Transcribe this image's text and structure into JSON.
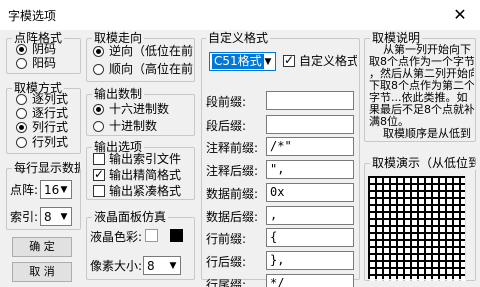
{
  "window": {
    "title": "字模选项",
    "close_glyph": "✕"
  },
  "dot_format": {
    "label": "点阵格式",
    "options": [
      {
        "label": "阴码",
        "selected": true
      },
      {
        "label": "阳码",
        "selected": false
      }
    ]
  },
  "scan_mode": {
    "label": "取模方式",
    "options": [
      {
        "label": "逐列式",
        "selected": false
      },
      {
        "label": "逐行式",
        "selected": false
      },
      {
        "label": "列行式",
        "selected": true
      },
      {
        "label": "行列式",
        "selected": false
      }
    ]
  },
  "per_line": {
    "label": "每行显示数据",
    "dot_label": "点阵:",
    "dot_value": "16",
    "index_label": "索引:",
    "index_value": "8"
  },
  "buttons": {
    "ok": "确  定",
    "cancel": "取  消"
  },
  "direction": {
    "label": "取模走向",
    "options": [
      {
        "label": "逆向（低位在前）",
        "selected": true
      },
      {
        "label": "顺向（高位在前）",
        "selected": false
      }
    ]
  },
  "radix": {
    "label": "输出数制",
    "options": [
      {
        "label": "十六进制数",
        "selected": true
      },
      {
        "label": "十进制数",
        "selected": false
      }
    ]
  },
  "output_options": {
    "label": "输出选项",
    "items": [
      {
        "label": "输出索引文件",
        "checked": false
      },
      {
        "label": "输出精简格式",
        "checked": true
      },
      {
        "label": "输出紧凑格式",
        "checked": false
      }
    ]
  },
  "lcd_panel": {
    "label": "液晶面板仿真",
    "color_label": "液晶色彩:",
    "pixel_label": "像素大小:",
    "pixel_value": "8",
    "colors": {
      "off": "#ffffff",
      "on": "#000000"
    }
  },
  "custom_format": {
    "label": "自定义格式",
    "format_value": "C51格式",
    "custom_checkbox_label": "自定义格式",
    "custom_checked": true,
    "fields": [
      {
        "label": "段前缀:",
        "value": ""
      },
      {
        "label": "段后缀:",
        "value": ""
      },
      {
        "label": "注释前缀:",
        "value": "/*\""
      },
      {
        "label": "注释后缀:",
        "value": "\","
      },
      {
        "label": "数据前缀:",
        "value": "0x"
      },
      {
        "label": "数据后缀:",
        "value": ","
      },
      {
        "label": "行前缀:",
        "value": "{"
      },
      {
        "label": "行后缀:",
        "value": "},"
      },
      {
        "label": "行尾缀:",
        "value": "*/"
      }
    ]
  },
  "explanation": {
    "label": "取模说明",
    "lines": [
      "    从第一列开始向下",
      "取8个点作为一个字节",
      "，然后从第二列开始向",
      "下取8个点作为第二个",
      "字节...依此类推。如",
      "果最后不足8个点就补",
      "满8位。",
      "    取模顺序是从低到"
    ]
  },
  "demo": {
    "label": "取模演示（从低位到高位）"
  }
}
